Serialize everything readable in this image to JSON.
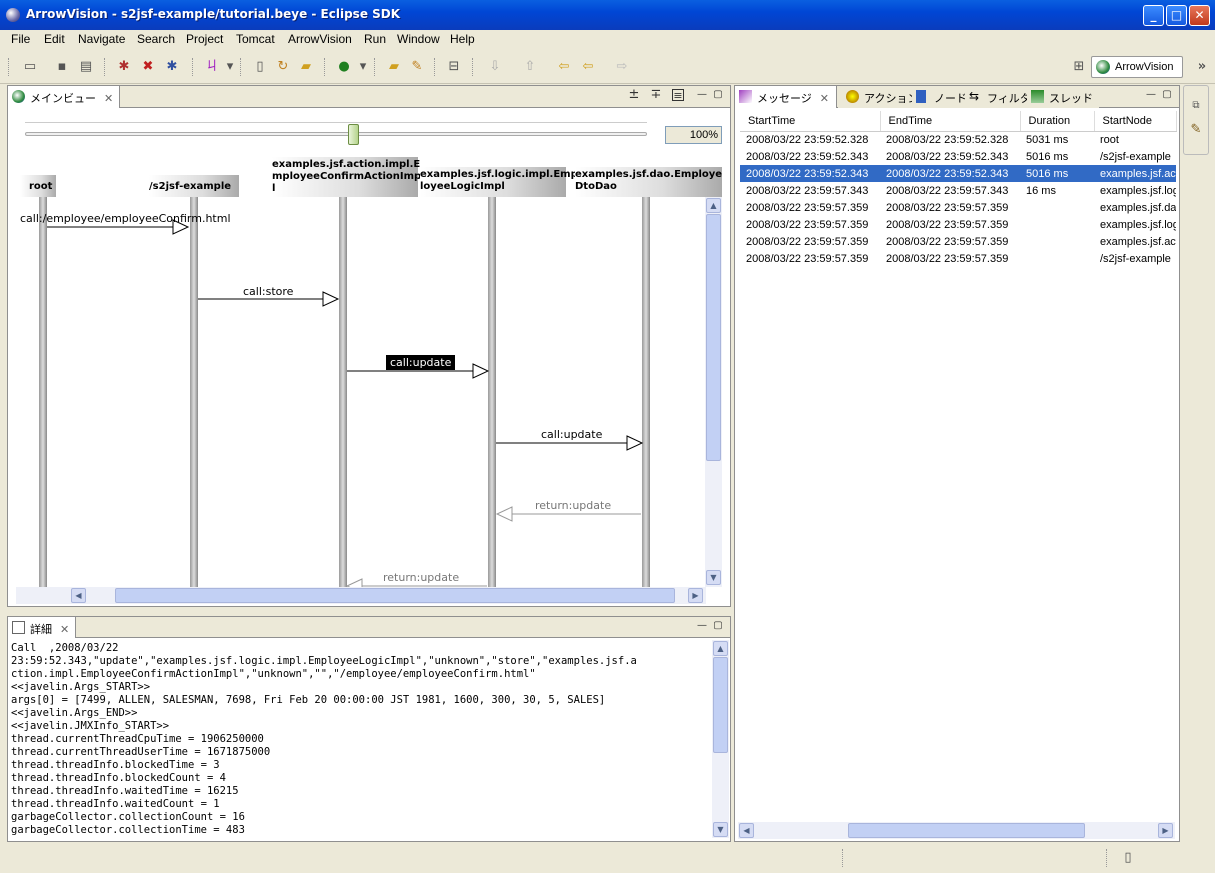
{
  "window": {
    "title": "ArrowVision - s2jsf-example/tutorial.beye - Eclipse SDK"
  },
  "menu": [
    "File",
    "Edit",
    "Navigate",
    "Search",
    "Project",
    "Tomcat",
    "ArrowVision",
    "Run",
    "Window",
    "Help"
  ],
  "perspective": {
    "label": "ArrowVision"
  },
  "main_view": {
    "tab": "メインビュー",
    "zoom": "100%",
    "lifelines": [
      {
        "name": "root"
      },
      {
        "name": "/s2jsf-example"
      },
      {
        "name": "examples.jsf.action.impl.EmployeeConfirmActionImpl"
      },
      {
        "name": "examples.jsf.logic.impl.EmployeeLogicImpl"
      },
      {
        "name": "examples.jsf.dao.EmployeeDtoDao"
      }
    ],
    "lifeline_heads": [
      [
        "root"
      ],
      [
        "/s2jsf-example"
      ],
      [
        "examples.jsf.action.impl.E",
        "mployeeConfirmActionImp",
        "l"
      ],
      [
        "examples.jsf.logic.impl.Emp",
        "loyeeLogicImpl"
      ],
      [
        "examples.jsf.dao.Employee",
        "DtoDao"
      ]
    ],
    "messages": [
      {
        "label": "call:/employee/employeeConfirm.html"
      },
      {
        "label": "call:store"
      },
      {
        "label": "call:update",
        "selected": true
      },
      {
        "label": "call:update"
      },
      {
        "label": "return:update"
      },
      {
        "label": "return:update"
      }
    ]
  },
  "detail": {
    "tab": "詳細",
    "lines": [
      "Call  ,2008/03/22",
      "23:59:52.343,\"update\",\"examples.jsf.logic.impl.EmployeeLogicImpl\",\"unknown\",\"store\",\"examples.jsf.a",
      "ction.impl.EmployeeConfirmActionImpl\",\"unknown\",\"\",\"/employee/employeeConfirm.html\"",
      "<<javelin.Args_START>>",
      "args[0] = [7499, ALLEN, SALESMAN, 7698, Fri Feb 20 00:00:00 JST 1981, 1600, 300, 30, 5, SALES]",
      "<<javelin.Args_END>>",
      "<<javelin.JMXInfo_START>>",
      "thread.currentThreadCpuTime = 1906250000",
      "thread.currentThreadUserTime = 1671875000",
      "thread.threadInfo.blockedTime = 3",
      "thread.threadInfo.blockedCount = 4",
      "thread.threadInfo.waitedTime = 16215",
      "thread.threadInfo.waitedCount = 1",
      "garbageCollector.collectionCount = 16",
      "garbageCollector.collectionTime = 483"
    ]
  },
  "message_view": {
    "tabs": [
      "メッセージ",
      "アクション",
      "ノード",
      "フィルタ",
      "スレッド"
    ],
    "columns": [
      "StartTime",
      "EndTime",
      "Duration",
      "StartNode"
    ],
    "rows": [
      [
        "2008/03/22 23:59:52.328",
        "2008/03/22 23:59:52.328",
        "5031 ms",
        "root"
      ],
      [
        "2008/03/22 23:59:52.343",
        "2008/03/22 23:59:52.343",
        "5016 ms",
        "/s2jsf-example"
      ],
      [
        "2008/03/22 23:59:52.343",
        "2008/03/22 23:59:52.343",
        "5016 ms",
        "examples.jsf.act"
      ],
      [
        "2008/03/22 23:59:57.343",
        "2008/03/22 23:59:57.343",
        "16 ms",
        "examples.jsf.log"
      ],
      [
        "2008/03/22 23:59:57.359",
        "2008/03/22 23:59:57.359",
        "",
        "examples.jsf.da"
      ],
      [
        "2008/03/22 23:59:57.359",
        "2008/03/22 23:59:57.359",
        "",
        "examples.jsf.log"
      ],
      [
        "2008/03/22 23:59:57.359",
        "2008/03/22 23:59:57.359",
        "",
        "examples.jsf.act"
      ],
      [
        "2008/03/22 23:59:57.359",
        "2008/03/22 23:59:57.359",
        "",
        "/s2jsf-example"
      ]
    ],
    "selected_row": 2
  },
  "colors": {
    "titlebar": "#0046d5",
    "selection": "#316ac5",
    "chrome": "#ece9d8"
  }
}
